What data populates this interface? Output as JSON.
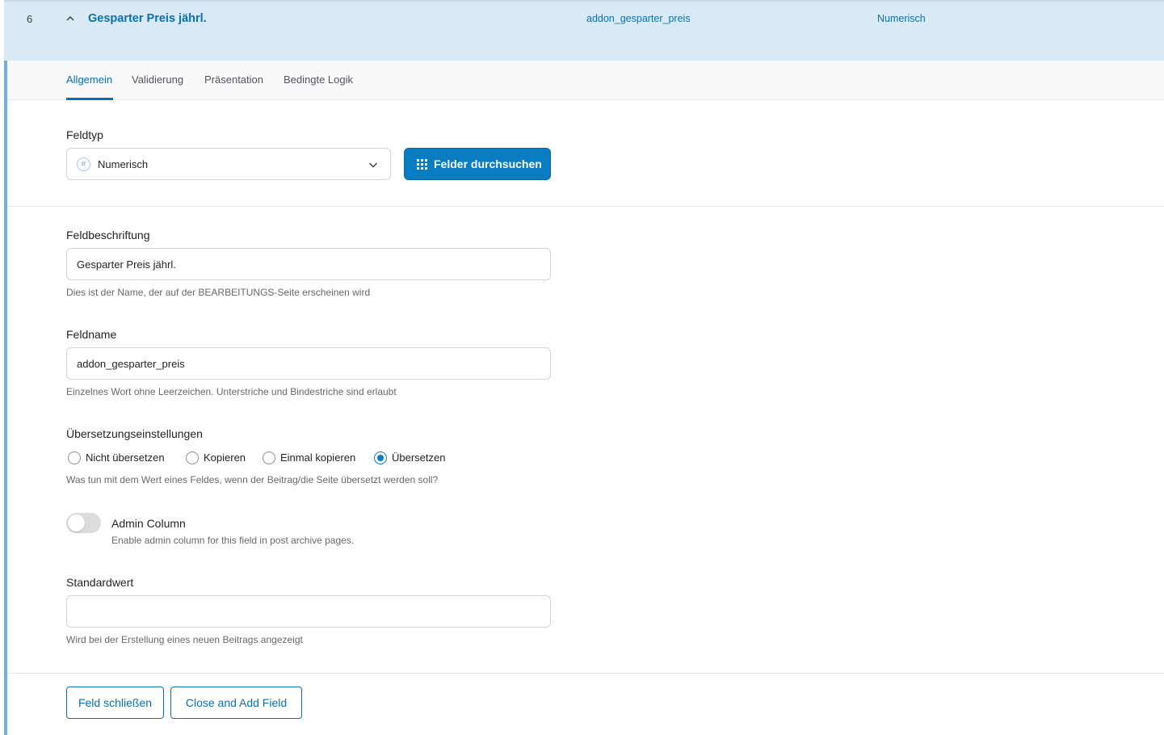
{
  "field_row": {
    "order": "6",
    "title": "Gesparter Preis jährl.",
    "name": "addon_gesparter_preis",
    "type": "Numerisch"
  },
  "tabs": [
    {
      "label": "Allgemein",
      "active": true
    },
    {
      "label": "Validierung",
      "active": false
    },
    {
      "label": "Präsentation",
      "active": false
    },
    {
      "label": "Bedingte Logik",
      "active": false
    }
  ],
  "field_type": {
    "label": "Feldtyp",
    "icon": "#",
    "selected": "Numerisch",
    "browse_button": "Felder durchsuchen"
  },
  "field_label": {
    "label": "Feldbeschriftung",
    "value": "Gesparter Preis jährl.",
    "help": "Dies ist der Name, der auf der BEARBEITUNGS-Seite erscheinen wird"
  },
  "field_name": {
    "label": "Feldname",
    "value": "addon_gesparter_preis",
    "help": "Einzelnes Wort ohne Leerzeichen. Unterstriche und Bindestriche sind erlaubt"
  },
  "translation": {
    "label": "Übersetzungseinstellungen",
    "options": [
      {
        "label": "Nicht übersetzen",
        "checked": false
      },
      {
        "label": "Kopieren",
        "checked": false
      },
      {
        "label": "Einmal kopieren",
        "checked": false
      },
      {
        "label": "Übersetzen",
        "checked": true
      }
    ],
    "help": "Was tun mit dem Wert eines Feldes, wenn der Beitrag/die Seite übersetzt werden soll?"
  },
  "admin_column": {
    "title": "Admin Column",
    "help": "Enable admin column for this field in post archive pages.",
    "enabled": false
  },
  "default_value": {
    "label": "Standardwert",
    "value": "",
    "help": "Wird bei der Erstellung eines neuen Beitrags angezeigt"
  },
  "footer": {
    "close_button": "Feld schließen",
    "close_add_button": "Close and Add Field"
  },
  "colors": {
    "accent": "#0a7dc2",
    "link": "#0a70b4",
    "header_bg": "#d9eaf4",
    "left_border": "#72aee6"
  }
}
